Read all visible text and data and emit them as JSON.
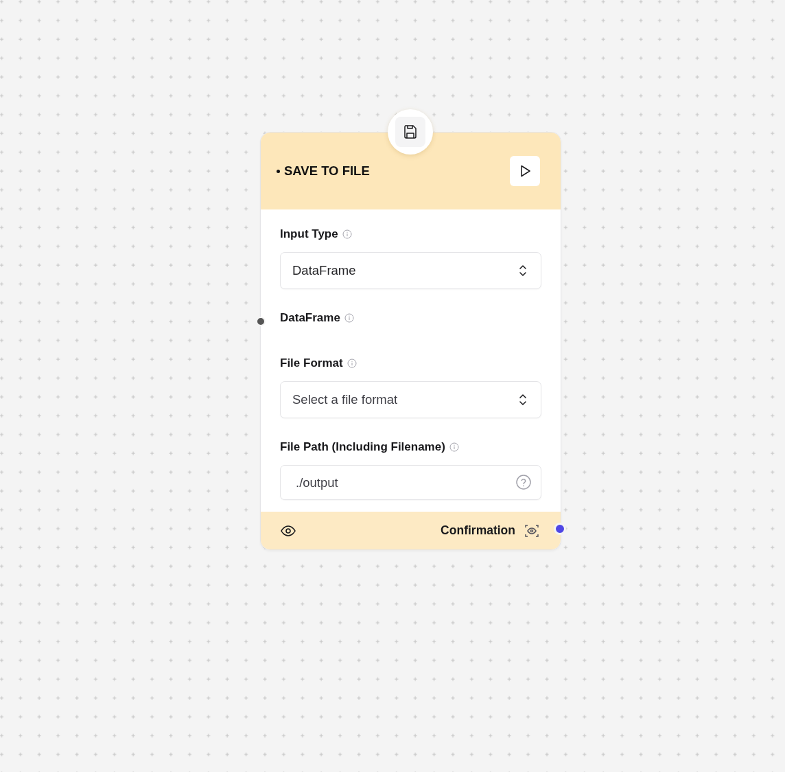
{
  "node": {
    "title": "SAVE TO FILE",
    "fields": [
      {
        "kind": "select",
        "label": "Input Type",
        "value": "DataFrame"
      },
      {
        "kind": "handle",
        "label": "DataFrame"
      },
      {
        "kind": "select",
        "label": "File Format",
        "placeholder": "Select a file format"
      },
      {
        "kind": "text",
        "label": "File Path (Including Filename)",
        "value": "./output"
      }
    ],
    "output": {
      "label": "Confirmation"
    }
  }
}
